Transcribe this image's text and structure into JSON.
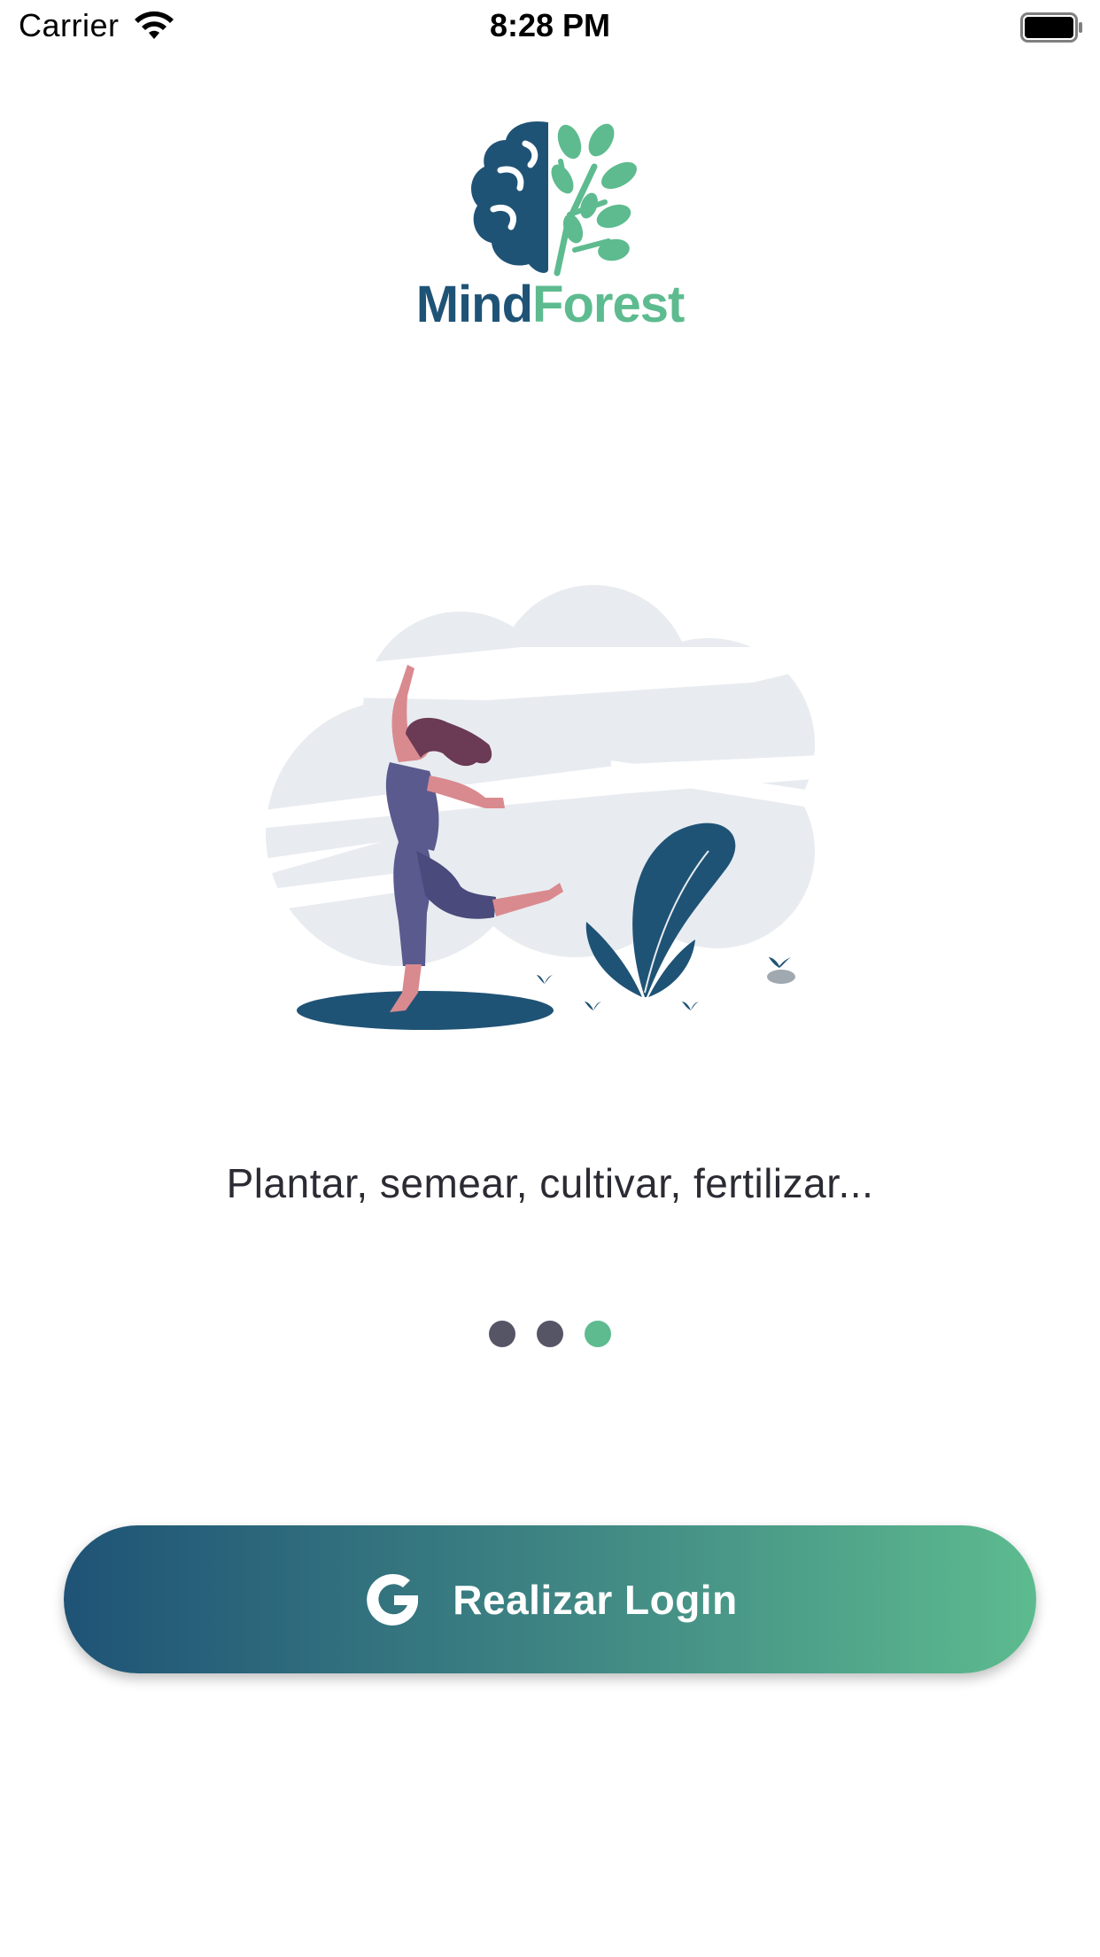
{
  "status_bar": {
    "carrier": "Carrier",
    "time": "8:28 PM",
    "icons": [
      "wifi-icon",
      "battery-icon"
    ]
  },
  "logo": {
    "word_part1": "Mind",
    "word_part2": "Forest",
    "colors": {
      "primary": "#1f5376",
      "secondary": "#5dbb8f"
    }
  },
  "illustration": {
    "icon": "dancing-woman-illustration"
  },
  "onboarding": {
    "caption": "Plantar, semear, cultivar, fertilizar...",
    "pages_total": 3,
    "page_active": 3
  },
  "login_button": {
    "label": "Realizar Login",
    "icon": "google-icon",
    "gradient": [
      "#1f5376",
      "#5dbb8f"
    ]
  }
}
